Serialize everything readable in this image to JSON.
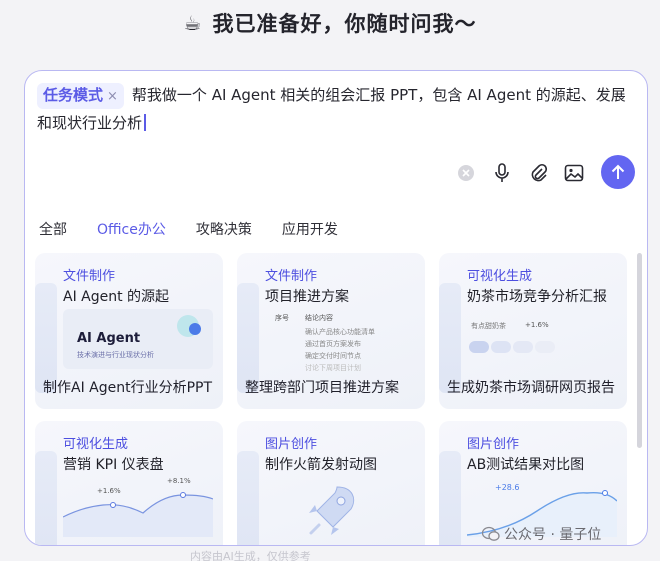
{
  "heading": {
    "icon": "coffee-cup-icon",
    "text": "我已准备好，你随时问我～"
  },
  "prompt": {
    "mode_tag": "任务模式",
    "text": "帮我做一个 AI Agent 相关的组会汇报 PPT，包含 AI Agent 的源起、发展和现状行业分析"
  },
  "toolbar": {
    "icons": [
      "clear-icon",
      "microphone-icon",
      "paperclip-icon",
      "image-icon",
      "send-arrow-icon"
    ]
  },
  "tabs": [
    {
      "label": "全部",
      "active": false
    },
    {
      "label": "Office办公",
      "active": true
    },
    {
      "label": "攻略决策",
      "active": false
    },
    {
      "label": "应用开发",
      "active": false
    }
  ],
  "cards": [
    {
      "category": "文件制作",
      "subtitle": "AI Agent 的源起",
      "label": "制作AI Agent行业分析PPT",
      "thumb": {
        "title": "AI Agent",
        "caption": "技术演进与行业现状分析"
      }
    },
    {
      "category": "文件制作",
      "subtitle": "项目推进方案",
      "label": "整理跨部门项目推进方案",
      "thumb": {
        "col1": "序号",
        "col2": "结论内容",
        "rows": [
          "确认产品核心功能清单",
          "通过首页方案发布",
          "确定交付时间节点",
          "讨论下周项目计划"
        ]
      }
    },
    {
      "category": "可视化生成",
      "subtitle": "奶茶市场竞争分析汇报",
      "label": "生成奶茶市场调研网页报告",
      "thumb": {
        "tag": "有点甜奶茶",
        "delta": "+1.6%"
      }
    },
    {
      "category": "可视化生成",
      "subtitle": "营销 KPI 仪表盘",
      "label": "",
      "thumb": {
        "delta1": "+1.6%",
        "delta2": "+8.1%"
      }
    },
    {
      "category": "图片创作",
      "subtitle": "制作火箭发射动图",
      "label": ""
    },
    {
      "category": "图片创作",
      "subtitle": "AB测试结果对比图",
      "label": "",
      "thumb": {
        "delta": "+28.6"
      }
    }
  ],
  "watermark": {
    "icon": "wechat-icon",
    "text": "公众号 · 量子位"
  },
  "footer": "内容由AI生成，仅供参考"
}
